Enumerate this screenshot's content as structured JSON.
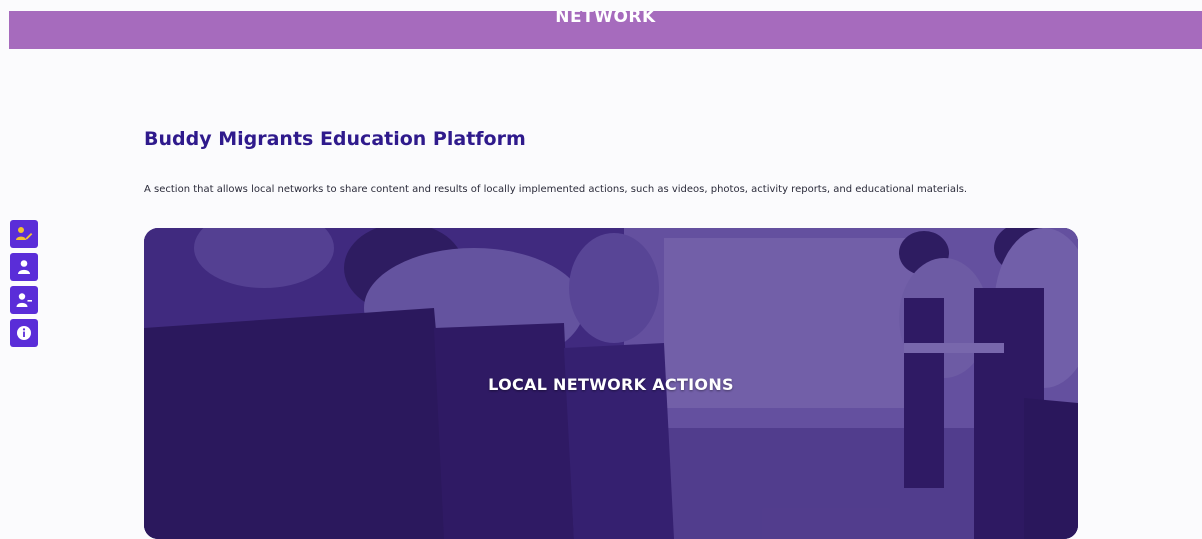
{
  "header": {
    "banner_title": "NETWORK",
    "banner_color": "#a66bbd"
  },
  "sidebar": {
    "buttons": [
      {
        "icon": "user-edit-icon"
      },
      {
        "icon": "user-icon"
      },
      {
        "icon": "user-minus-icon"
      },
      {
        "icon": "info-icon"
      }
    ],
    "button_color": "#5a2dd8"
  },
  "main": {
    "heading": "Buddy Migrants Education Platform",
    "description": "A section that allows local networks to share content and results of locally implemented actions, such as videos, photos, activity reports, and educational materials.",
    "hero": {
      "label": "LOCAL NETWORK ACTIONS",
      "overlay_color": "#3d2a73"
    }
  }
}
